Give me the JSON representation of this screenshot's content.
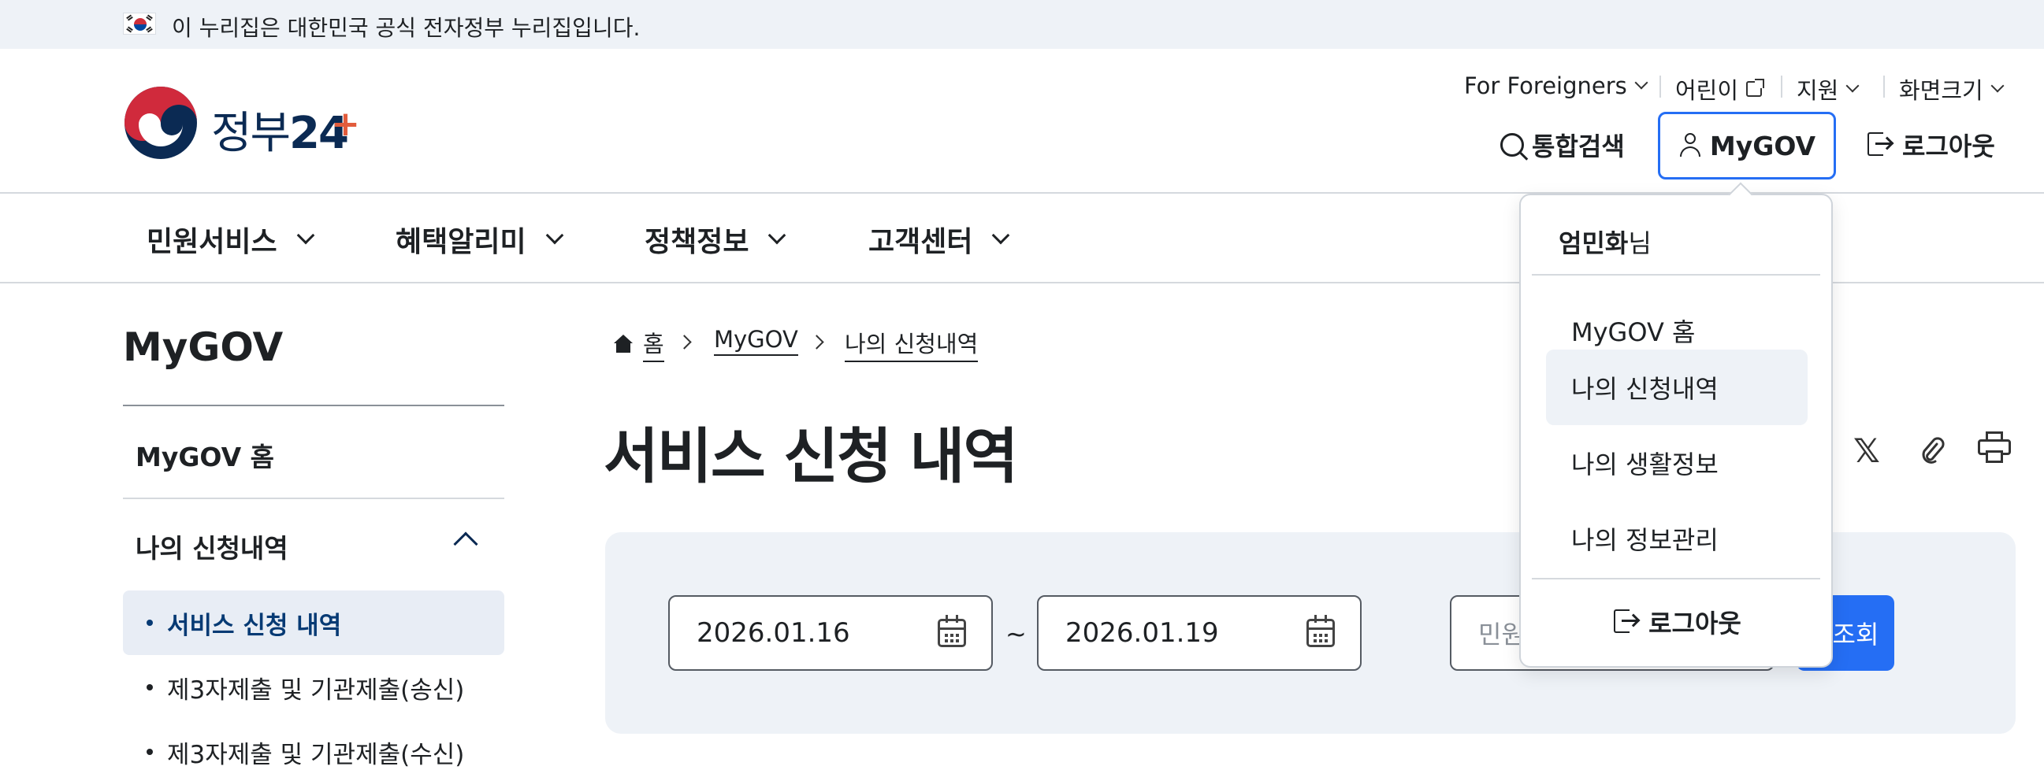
{
  "gov_banner": {
    "text": "이 누리집은 대한민국 공식 전자정부 누리집입니다."
  },
  "logo": {
    "text": "정부",
    "number": "24",
    "plus": "+"
  },
  "util_menu": {
    "foreigners": "For Foreigners",
    "kids": "어린이",
    "support": "지원",
    "screen_size": "화면크기"
  },
  "header_actions": {
    "search": "통합검색",
    "mygov": "MyGOV",
    "logout": "로그아웃"
  },
  "nav": {
    "items": [
      {
        "label": "민원서비스"
      },
      {
        "label": "혜택알리미"
      },
      {
        "label": "정책정보"
      },
      {
        "label": "고객센터"
      }
    ]
  },
  "sidebar": {
    "title": "MyGOV",
    "home": "MyGOV 홈",
    "section": "나의 신청내역",
    "sub_items": [
      {
        "label": "서비스 신청 내역",
        "active": true
      },
      {
        "label": "제3자제출 및 기관제출(송신)",
        "active": false
      },
      {
        "label": "제3자제출 및 기관제출(수신)",
        "active": false
      }
    ]
  },
  "breadcrumb": {
    "home": "홈",
    "level1": "MyGOV",
    "level2": "나의 신청내역"
  },
  "page": {
    "title": "서비스 신청 내역"
  },
  "share": {
    "x_glyph": "𝕏"
  },
  "search_panel": {
    "start_date": "2026.01.16",
    "end_date": "2026.01.19",
    "tilde": "~",
    "keyword_placeholder": "민원",
    "query_button": "조회"
  },
  "mygov_dropdown": {
    "user_name": "엄민화",
    "user_suffix": "님",
    "items": [
      {
        "label": "MyGOV 홈",
        "active": false
      },
      {
        "label": "나의 신청내역",
        "active": true
      },
      {
        "label": "나의 생활정보",
        "active": false
      },
      {
        "label": "나의 정보관리",
        "active": false
      }
    ],
    "logout": "로그아웃"
  },
  "colors": {
    "accent": "#256ef4",
    "navy": "#0b2a53",
    "panel_bg": "#eef2f7",
    "active_sub_text": "#063a74"
  }
}
